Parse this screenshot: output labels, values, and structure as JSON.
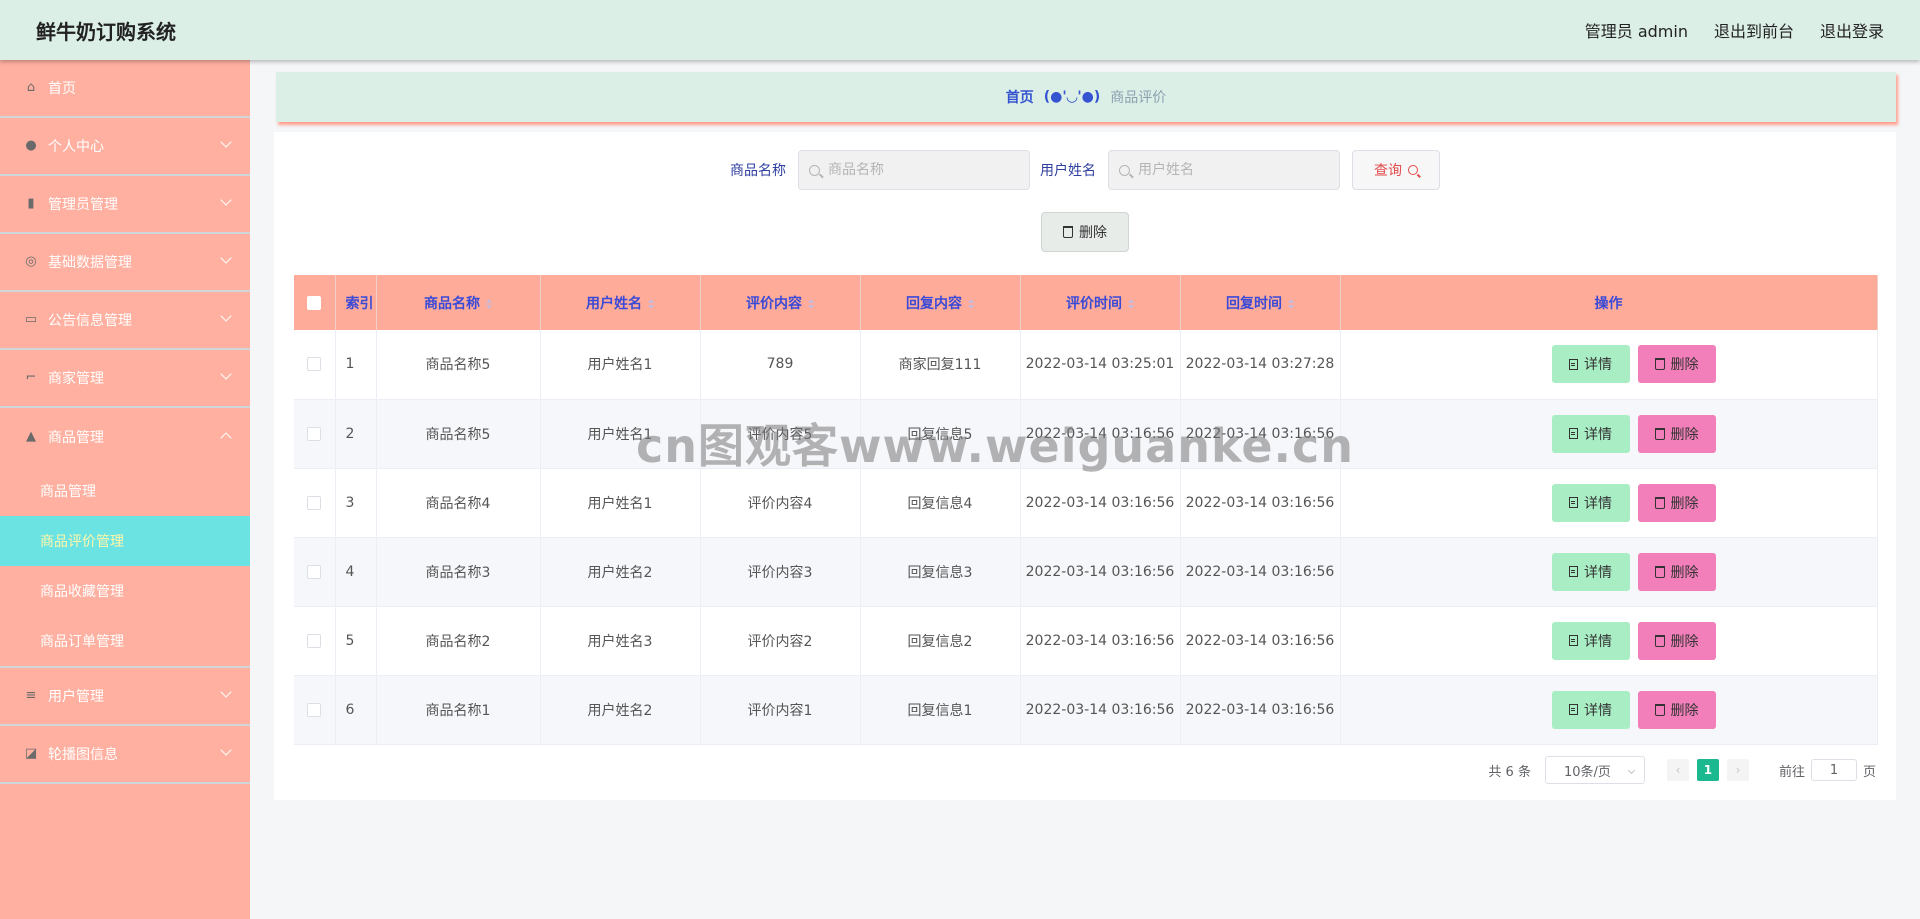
{
  "header": {
    "brand": "鲜牛奶订购系统",
    "user": "管理员 admin",
    "front": "退出到前台",
    "logout": "退出登录"
  },
  "sidebar": {
    "items": [
      {
        "label": "首页",
        "icon": "home-icon"
      },
      {
        "label": "个人中心",
        "icon": "user-icon"
      },
      {
        "label": "管理员管理",
        "icon": "mic-icon"
      },
      {
        "label": "基础数据管理",
        "icon": "dashboard-icon"
      },
      {
        "label": "公告信息管理",
        "icon": "card-icon"
      },
      {
        "label": "商家管理",
        "icon": "crop-icon"
      },
      {
        "label": "商品管理",
        "icon": "shop-icon"
      },
      {
        "label": "用户管理",
        "icon": "sliders-icon"
      },
      {
        "label": "轮播图信息",
        "icon": "chart-icon"
      }
    ],
    "sub_items": [
      "商品管理",
      "商品评价管理",
      "商品收藏管理",
      "商品订单管理"
    ]
  },
  "breadcrumb": {
    "home": "首页",
    "sep": "(●'◡'●)",
    "current": "商品评价"
  },
  "search": {
    "name_label": "商品名称",
    "name_placeholder": "商品名称",
    "user_label": "用户姓名",
    "user_placeholder": "用户姓名",
    "query_label": "查询"
  },
  "toolbar": {
    "delete_label": "删除"
  },
  "table": {
    "headers": [
      "索引",
      "商品名称",
      "用户姓名",
      "评价内容",
      "回复内容",
      "评价时间",
      "回复时间",
      "操作"
    ],
    "rows": [
      [
        "1",
        "商品名称5",
        "用户姓名1",
        "789",
        "商家回复111",
        "2022-03-14 03:25:01",
        "2022-03-14 03:27:28"
      ],
      [
        "2",
        "商品名称5",
        "用户姓名1",
        "评价内容5",
        "回复信息5",
        "2022-03-14 03:16:56",
        "2022-03-14 03:16:56"
      ],
      [
        "3",
        "商品名称4",
        "用户姓名1",
        "评价内容4",
        "回复信息4",
        "2022-03-14 03:16:56",
        "2022-03-14 03:16:56"
      ],
      [
        "4",
        "商品名称3",
        "用户姓名2",
        "评价内容3",
        "回复信息3",
        "2022-03-14 03:16:56",
        "2022-03-14 03:16:56"
      ],
      [
        "5",
        "商品名称2",
        "用户姓名3",
        "评价内容2",
        "回复信息2",
        "2022-03-14 03:16:56",
        "2022-03-14 03:16:56"
      ],
      [
        "6",
        "商品名称1",
        "用户姓名2",
        "评价内容1",
        "回复信息1",
        "2022-03-14 03:16:56",
        "2022-03-14 03:16:56"
      ]
    ],
    "detail_label": "详情",
    "remove_label": "删除"
  },
  "pager": {
    "total": "共 6 条",
    "page_size": "10条/页",
    "current_page": "1",
    "goto_label": "前往",
    "goto_value": "1",
    "page_suffix": "页"
  },
  "watermark": "cn图观客www.weiguanke.cn",
  "colors": {
    "header_bg": "#dcefe7",
    "sidebar_bg": "#ffb0a0",
    "active_sub_bg": "#6ce3e3",
    "table_header_bg": "#ffab9a",
    "detail_btn": "#a9edc5",
    "remove_btn": "#f27fb9",
    "page_active": "#1cb88f"
  }
}
